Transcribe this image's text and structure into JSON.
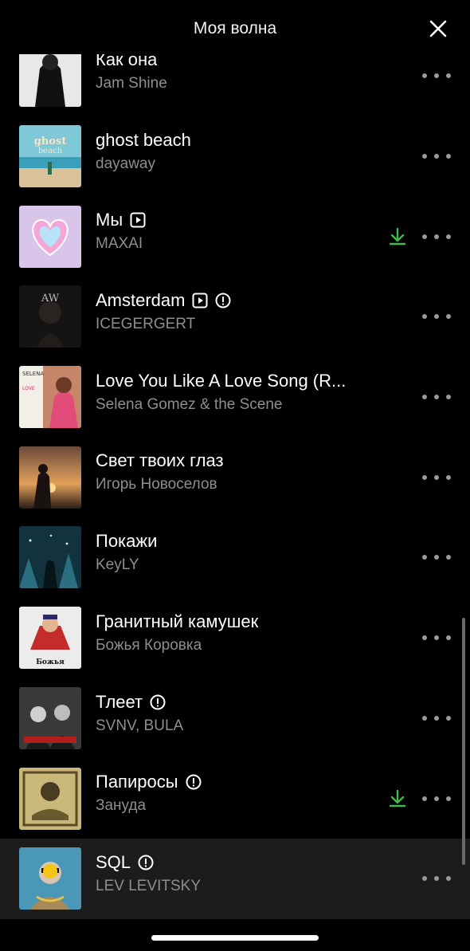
{
  "header": {
    "title": "Моя волна",
    "close_icon": "close-icon"
  },
  "tracks": [
    {
      "title": "Как она",
      "artist": "Jam Shine",
      "video": false,
      "explicit": false,
      "downloaded": false
    },
    {
      "title": "ghost beach",
      "artist": "dayaway",
      "video": false,
      "explicit": false,
      "downloaded": false
    },
    {
      "title": "Мы",
      "artist": "MAXAI",
      "video": true,
      "explicit": false,
      "downloaded": true
    },
    {
      "title": "Amsterdam",
      "artist": "ICEGERGERT",
      "video": true,
      "explicit": true,
      "downloaded": false
    },
    {
      "title": "Love You Like A Love Song (R...",
      "artist": "Selena Gomez & the Scene",
      "video": false,
      "explicit": false,
      "downloaded": false
    },
    {
      "title": "Свет твоих глаз",
      "artist": "Игорь Новоселов",
      "video": false,
      "explicit": false,
      "downloaded": false
    },
    {
      "title": "Покажи",
      "artist": "KeyLY",
      "video": false,
      "explicit": false,
      "downloaded": false
    },
    {
      "title": "Гранитный камушек",
      "artist": "Божья Коровка",
      "video": false,
      "explicit": false,
      "downloaded": false
    },
    {
      "title": "Тлеет",
      "artist": "SVNV, BULA",
      "video": false,
      "explicit": true,
      "downloaded": false
    },
    {
      "title": "Папиросы",
      "artist": "Зануда",
      "video": false,
      "explicit": true,
      "downloaded": true
    },
    {
      "title": "SQL",
      "artist": "LEV LEVITSKY",
      "video": false,
      "explicit": true,
      "downloaded": false,
      "playing": true
    }
  ],
  "colors": {
    "background": "#000000",
    "accent_download": "#3fb950",
    "artist_text": "#8e8e8e",
    "active_row": "#1c1c1c",
    "playing_indicator": "#f5c518"
  }
}
